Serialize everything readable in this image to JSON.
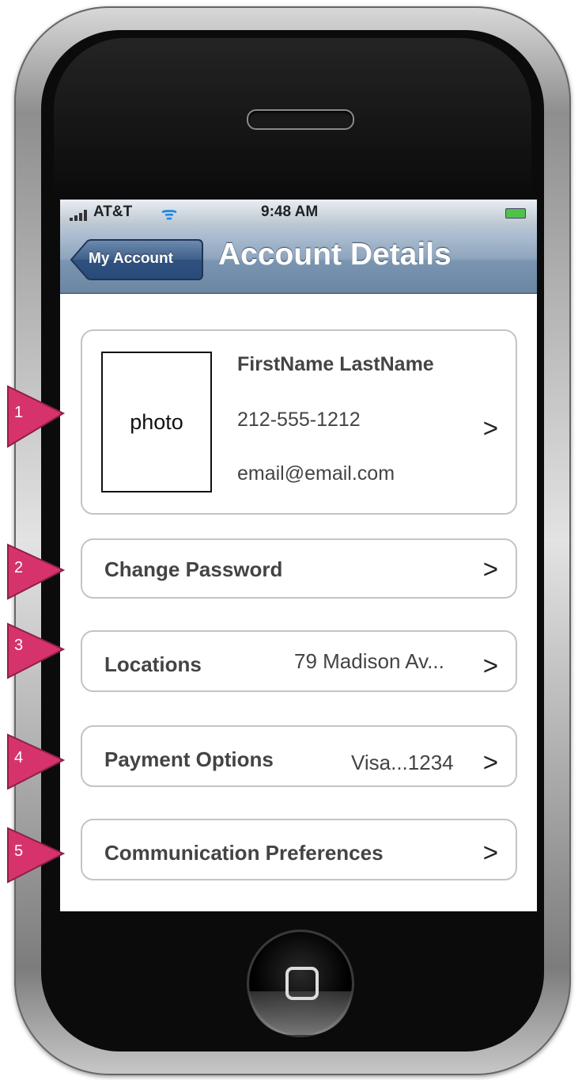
{
  "status_bar": {
    "carrier": "AT&T",
    "time": "9:48 AM"
  },
  "nav": {
    "back_label": "My Account",
    "title": "Account Details"
  },
  "profile": {
    "photo_label": "photo",
    "name": "FirstName LastName",
    "phone": "212-555-1212",
    "email": "email@email.com",
    "chevron": ">"
  },
  "rows": {
    "change_password": {
      "label": "Change Password",
      "chevron": ">"
    },
    "locations": {
      "label": "Locations",
      "value": "79 Madison Av...",
      "chevron": ">"
    },
    "payment": {
      "label": "Payment Options",
      "value": "Visa...1234",
      "chevron": ">"
    },
    "communication": {
      "label": "Communication Preferences",
      "chevron": ">"
    }
  },
  "callouts": [
    "1",
    "2",
    "3",
    "4",
    "5"
  ],
  "colors": {
    "callout": "#d6336c",
    "nav_bar": "#7a95b1",
    "card_border": "#c4c4c4"
  }
}
